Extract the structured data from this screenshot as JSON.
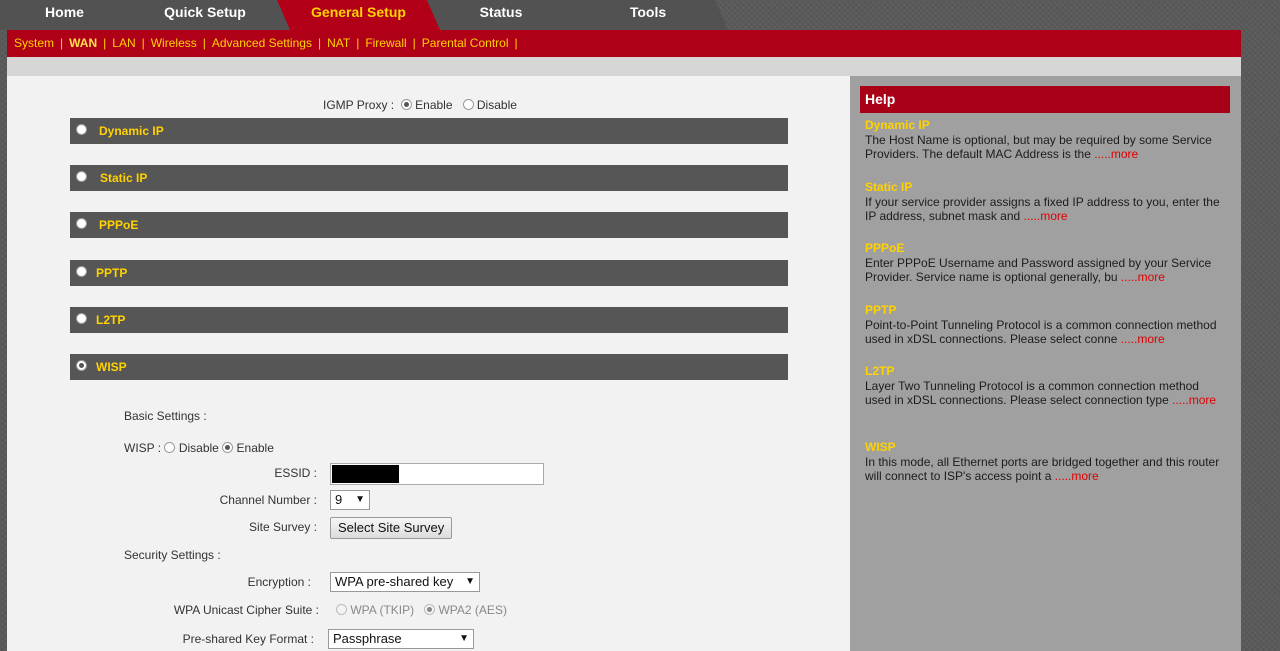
{
  "tabs": [
    {
      "label": "Home"
    },
    {
      "label": "Quick Setup"
    },
    {
      "label": "General Setup"
    },
    {
      "label": "Status"
    },
    {
      "label": "Tools"
    }
  ],
  "subnav": [
    "System",
    "WAN",
    "LAN",
    "Wireless",
    "Advanced Settings",
    "NAT",
    "Firewall",
    "Parental Control"
  ],
  "subnav_sep": "|",
  "igmp": {
    "label": "IGMP Proxy :",
    "enable": "Enable",
    "disable": "Disable",
    "selected": "Enable"
  },
  "connection_types": [
    "Dynamic IP",
    "Static IP",
    "PPPoE",
    "PPTP",
    "L2TP",
    "WISP"
  ],
  "selected_connection": "WISP",
  "wisp": {
    "basic_settings": "Basic Settings :",
    "wisp_label": "WISP :",
    "disable": "Disable",
    "enable": "Enable",
    "essid_label": "ESSID :",
    "channel_label": "Channel Number :",
    "channel_value": "9",
    "site_survey_label": "Site Survey :",
    "site_survey_button": "Select Site Survey",
    "security_settings": "Security Settings :",
    "encryption_label": "Encryption :",
    "encryption_value": "WPA pre-shared key",
    "cipher_label": "WPA Unicast Cipher Suite :",
    "cipher_tkip": "WPA (TKIP)",
    "cipher_aes": "WPA2 (AES)",
    "key_format_label": "Pre-shared Key Format :",
    "key_format_value": "Passphrase"
  },
  "help": {
    "title": "Help",
    "more": ".....more",
    "items": [
      {
        "title": "Dynamic IP",
        "text": "The Host Name is optional, but may be required by some Service Providers. The default MAC Address is the "
      },
      {
        "title": "Static IP",
        "text": "If your service provider assigns a fixed IP address to you, enter the IP address, subnet mask and "
      },
      {
        "title": "PPPoE",
        "text": "Enter PPPoE Username and Password assigned by your Service Provider. Service name is optional generally, bu "
      },
      {
        "title": "PPTP",
        "text": "Point-to-Point Tunneling Protocol is a common connection method used in xDSL connections. Please select conne "
      },
      {
        "title": "L2TP",
        "text": "Layer Two Tunneling Protocol is a common connection method used in xDSL connections. Please select connection type "
      },
      {
        "title": "WISP",
        "text": "In this mode, all Ethernet ports are bridged together and this router will connect to ISP's access point a "
      }
    ]
  },
  "colors": {
    "brand_red": "#b00018",
    "accent_yellow": "#ffd200",
    "bar_gray": "#565656",
    "more_red": "#e00000"
  }
}
